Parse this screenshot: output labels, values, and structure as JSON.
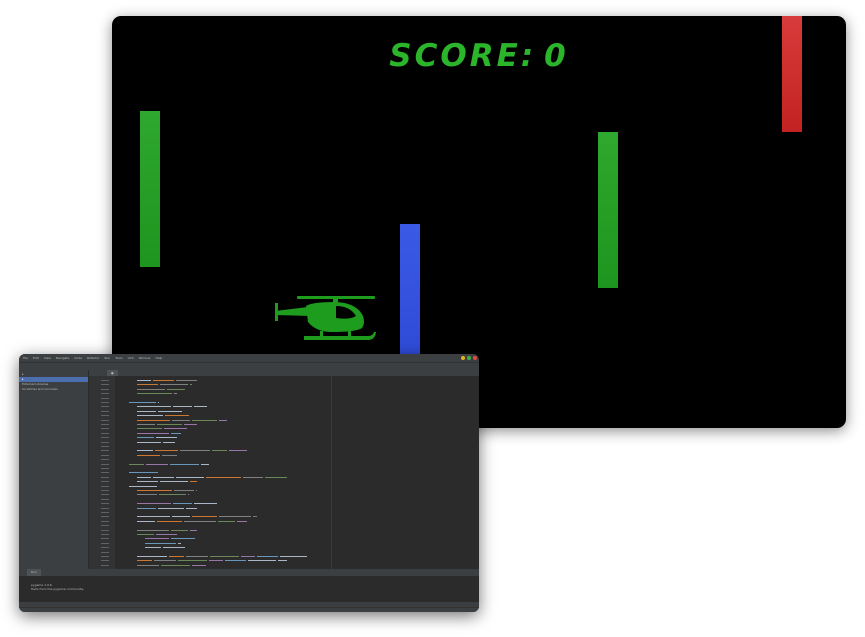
{
  "game": {
    "score_label": "SCORE:",
    "score_value": "0",
    "colors": {
      "background": "#000000",
      "text": "#2bb52b",
      "helicopter": "#1e9c1e"
    },
    "obstacles": [
      {
        "name": "green-obstacle-1",
        "color": "green"
      },
      {
        "name": "blue-obstacle",
        "color": "blue"
      },
      {
        "name": "green-obstacle-2",
        "color": "green"
      },
      {
        "name": "red-obstacle",
        "color": "red"
      }
    ],
    "player_icon": "helicopter-icon"
  },
  "ide": {
    "menu": [
      "File",
      "Edit",
      "View",
      "Navigate",
      "Code",
      "Refactor",
      "Run",
      "Tools",
      "VCS",
      "Window",
      "Help"
    ],
    "project_items": [
      {
        "label": "External Libraries"
      },
      {
        "label": "Scratches and Consoles"
      }
    ],
    "run_tab": "Run",
    "console_lines": [
      "pygame 1.9.6",
      "Hello from the pygame community."
    ],
    "colors": {
      "editor_bg": "#2b2b2b",
      "panel_bg": "#3c3f41",
      "selection": "#4b6eaf",
      "link": "#287bde"
    }
  }
}
